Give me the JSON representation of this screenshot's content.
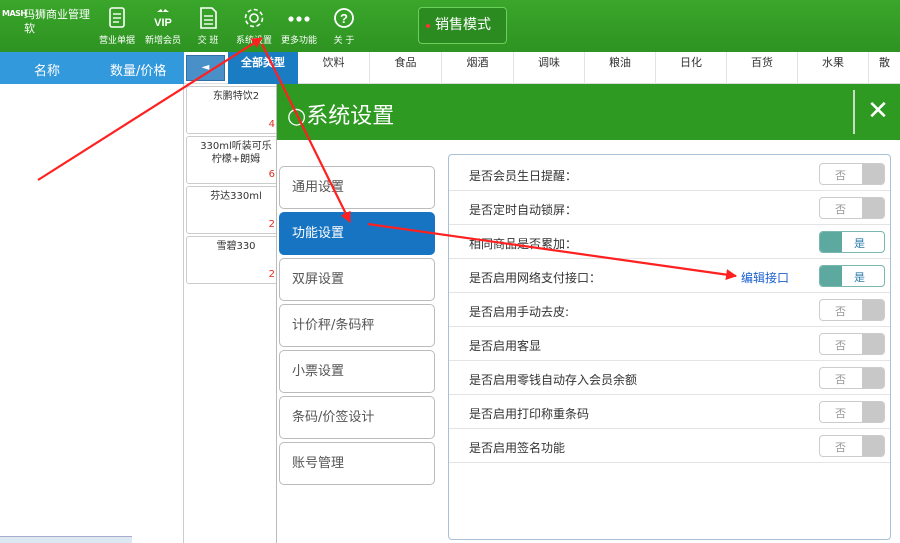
{
  "app": {
    "logo_mark": "MASH",
    "title": "玛狮商业管理软"
  },
  "toolbar": {
    "items": [
      {
        "label": "营业单据",
        "icon": "receipt-icon"
      },
      {
        "label": "新增会员",
        "icon": "vip-icon"
      },
      {
        "label": "交  班",
        "icon": "document-icon"
      },
      {
        "label": "系统设置",
        "icon": "gear-icon"
      },
      {
        "label": "更多功能",
        "icon": "more-dots-icon"
      },
      {
        "label": "关  于",
        "icon": "question-icon"
      }
    ],
    "mode_button": "销售模式"
  },
  "cart": {
    "col_name": "名称",
    "col_qty_price": "数量/价格"
  },
  "categories": {
    "back": "◄",
    "all": "全部类型",
    "items": [
      "饮料",
      "食品",
      "烟酒",
      "调味",
      "粮油",
      "日化",
      "百货",
      "水果",
      "散"
    ]
  },
  "products": [
    {
      "name": "东鹏特饮2",
      "price": "4"
    },
    {
      "name": "330ml听装可乐",
      "name2": "柠檬+朗姆",
      "price": "6"
    },
    {
      "name": "芬达330ml",
      "price": "2"
    },
    {
      "name": "雪碧330",
      "price": "2"
    }
  ],
  "dialog": {
    "title": "○系统设置",
    "close": "✕",
    "menu": [
      {
        "label": "通用设置",
        "active": false
      },
      {
        "label": "功能设置",
        "active": true
      },
      {
        "label": "双屏设置",
        "active": false
      },
      {
        "label": "计价秤/条码秤",
        "active": false
      },
      {
        "label": "小票设置",
        "active": false
      },
      {
        "label": "条码/价签设计",
        "active": false
      },
      {
        "label": "账号管理",
        "active": false
      }
    ],
    "options": [
      {
        "label": "是否会员生日提醒：",
        "value": "否",
        "on": false
      },
      {
        "label": "是否定时自动锁屏：",
        "value": "否",
        "on": false
      },
      {
        "label": "相同商品是否累加：",
        "value": "是",
        "on": true
      },
      {
        "label": "是否启用网络支付接口：",
        "value": "是",
        "on": true,
        "link": "编辑接口"
      },
      {
        "label": "是否启用手动去皮:",
        "value": "否",
        "on": false
      },
      {
        "label": "是否启用客显",
        "value": "否",
        "on": false
      },
      {
        "label": "是否启用零钱自动存入会员余额",
        "value": "否",
        "on": false
      },
      {
        "label": "是否启用打印称重条码",
        "value": "否",
        "on": false
      },
      {
        "label": "是否启用签名功能",
        "value": "否",
        "on": false
      }
    ]
  },
  "colors": {
    "toolbar_green": "#2e9322",
    "active_blue": "#1774c2",
    "annotation_red": "#ff2020"
  }
}
